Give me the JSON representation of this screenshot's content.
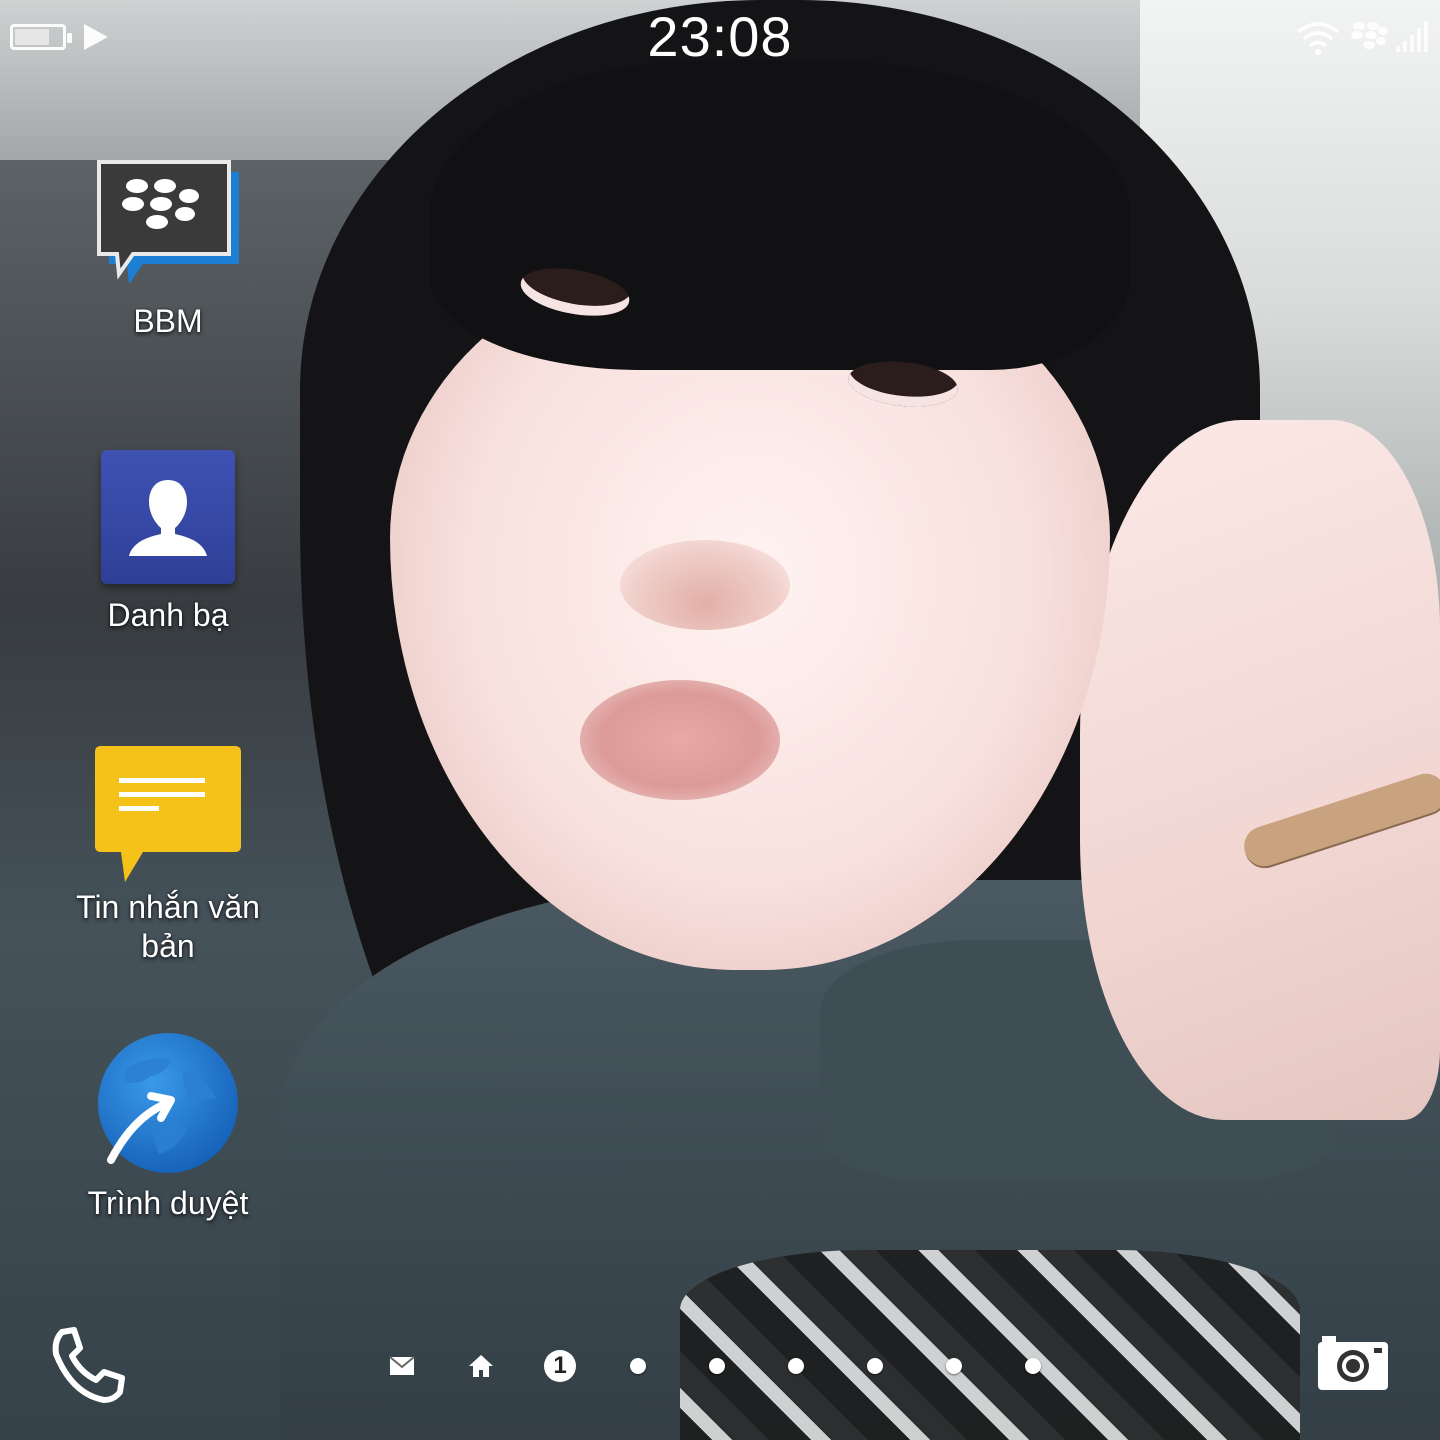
{
  "status_bar": {
    "time": "23:08",
    "battery_level": 0.75,
    "icons": [
      "battery-icon",
      "media-playing-icon",
      "wifi-icon",
      "blackberry-logo-icon",
      "signal-strength-icon"
    ]
  },
  "apps": [
    {
      "name": "BBM",
      "icon": "bbm-icon"
    },
    {
      "name": "Danh bạ",
      "icon": "contacts-icon"
    },
    {
      "name": "Tin nhắn văn bản",
      "icon": "text-messages-icon"
    },
    {
      "name": "Trình duyệt",
      "icon": "browser-icon"
    }
  ],
  "dock": {
    "left_icon": "phone-icon",
    "right_icon": "camera-icon",
    "page_indicators": [
      {
        "icon": "hub-mail-icon"
      },
      {
        "icon": "home-icon"
      },
      {
        "icon": "page-badge",
        "label": "1"
      },
      {
        "icon": "page-dot"
      },
      {
        "icon": "page-dot"
      },
      {
        "icon": "page-dot"
      },
      {
        "icon": "page-dot"
      },
      {
        "icon": "page-dot"
      },
      {
        "icon": "page-dot"
      }
    ]
  },
  "colors": {
    "contacts_blue": "#3f52b3",
    "messages_yellow": "#f5c21a",
    "browser_blue": "#1f7fd6",
    "bbm_dark": "#3a3a3a",
    "bbm_accent_blue": "#1c7fd4"
  }
}
